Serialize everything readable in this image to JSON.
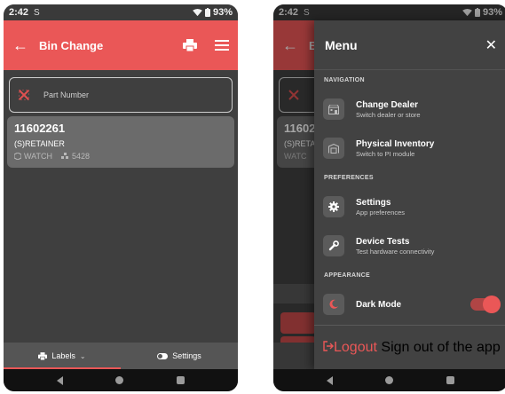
{
  "status": {
    "time": "2:42",
    "sim_icon": "S",
    "battery": "93%"
  },
  "screen_a": {
    "title": "Bin Change",
    "search_placeholder": "Part Number",
    "card": {
      "part_number": "11602261",
      "description": "(S)RETAINER",
      "location": "WATCH",
      "qty": "5428"
    },
    "tabs": [
      {
        "label": "Labels",
        "icon": "printer-icon",
        "active": true
      },
      {
        "label": "Settings",
        "icon": "toggle-icon",
        "active": false
      }
    ]
  },
  "screen_b": {
    "bg_title_peek": "B",
    "bg_card_peek": "11602",
    "bg_desc_peek": "(S)RETAI",
    "bg_loc_peek": "WATC",
    "menu": {
      "title": "Menu",
      "sections": {
        "navigation": "NAVIGATION",
        "preferences": "PREFERENCES",
        "appearance": "APPEARANCE"
      },
      "items": [
        {
          "label": "Change Dealer",
          "sub": "Switch dealer or store",
          "icon": "store-icon"
        },
        {
          "label": "Physical Inventory",
          "sub": "Switch to PI module",
          "icon": "warehouse-icon"
        },
        {
          "label": "Settings",
          "sub": "App preferences",
          "icon": "gear-icon"
        },
        {
          "label": "Device Tests",
          "sub": "Test hardware connectivity",
          "icon": "wrench-icon"
        },
        {
          "label": "Dark Mode",
          "sub": "",
          "icon": "moon-icon",
          "toggle_on": true
        }
      ],
      "logout": {
        "label": "Logout",
        "sub": "Sign out of the app"
      }
    }
  },
  "colors": {
    "accent": "#ea5757",
    "background": "#3f3f3f",
    "card": "#6b6b6b",
    "drawer": "#424242"
  }
}
